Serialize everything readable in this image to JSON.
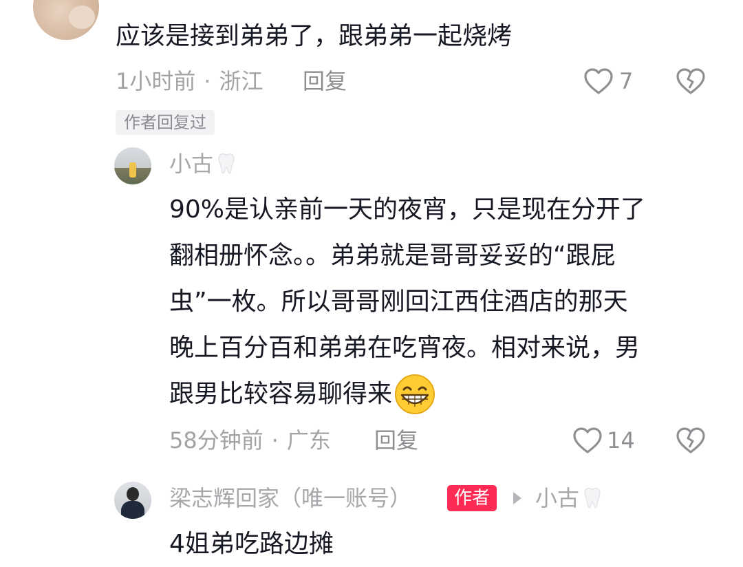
{
  "top_comment": {
    "text": "应该是接到弟弟了，跟弟弟一起烧烤",
    "time": "1小时前",
    "separator": "·",
    "location": "浙江",
    "reply_label": "回复",
    "likes": "7",
    "author_replied_badge": "作者回复过"
  },
  "reply_1": {
    "username": "小古",
    "text_lines": [
      "90%是认亲前一天的夜宵，只是现在分开了",
      "翻相册怀念。。弟弟就是哥哥妥妥的“跟屁",
      "虫”一枚。所以哥哥刚回江西住酒店的那天",
      "晚上百分百和弟弟在吃宵夜。相对来说，男",
      "跟男比较容易聊得来"
    ],
    "time": "58分钟前",
    "separator": "·",
    "location": "广东",
    "reply_label": "回复",
    "likes": "14"
  },
  "reply_2": {
    "username": "梁志辉回家（唯一账号）",
    "author_tag": "作者",
    "reply_to": "小古",
    "text_partial": "4姐弟吃路边摊"
  },
  "icons": {
    "like": "heart-outline-icon",
    "dislike": "broken-heart-icon",
    "badge": "tooth-icon",
    "emoji": "grinning-face-icon",
    "reply_arrow": "triangle-right-icon"
  },
  "colors": {
    "author_tag_bg": "#fe2c55",
    "meta_text": "#a3a3a6",
    "main_text": "#161823"
  }
}
